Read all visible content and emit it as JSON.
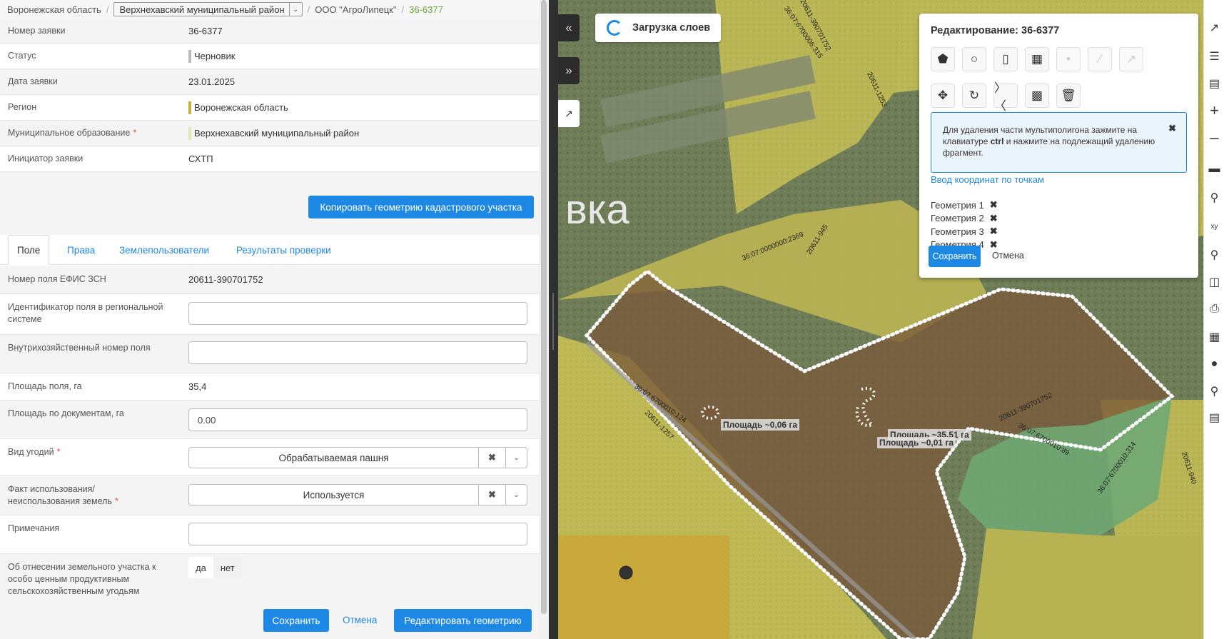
{
  "breadcrumb": {
    "region": "Воронежская область",
    "district": "Верхнехавский муниципальный район",
    "org": "ООО \"АгроЛипецк\"",
    "current": "36-6377"
  },
  "info_rows": [
    {
      "label": "Номер заявки",
      "value": "36-6377"
    },
    {
      "label": "Статус",
      "value": "Черновик",
      "bar": "#bbbbbb"
    },
    {
      "label": "Дата заявки",
      "value": "23.01.2025"
    },
    {
      "label": "Регион",
      "value": "Воронежская область",
      "bar": "#c8b040"
    },
    {
      "label": "Муниципальное образование",
      "value": "Верхнехавский муниципальный район",
      "bar": "#e0e8b0",
      "required": true
    },
    {
      "label": "Инициатор заявки",
      "value": "СХТП"
    }
  ],
  "copy_button": "Копировать геометрию кадастрового участка",
  "tabs": [
    "Поле",
    "Права",
    "Землепользователи",
    "Результаты проверки"
  ],
  "field": {
    "efis_label": "Номер поля ЕФИС ЗСН",
    "efis_value": "20611-390701752",
    "regional_id_label": "Идентификатор поля в региональной системе",
    "regional_id_value": "",
    "internal_no_label": "Внутрихозяйственный номер поля",
    "internal_no_value": "",
    "area_label": "Площадь поля, га",
    "area_value": "35,4",
    "docs_area_label": "Площадь по документам, га",
    "docs_area_value": "0.00",
    "land_type_label": "Вид угодий",
    "land_type_value": "Обрабатываемая пашня",
    "usage_label": "Факт использования/ неиспользования земель",
    "usage_value": "Используется",
    "notes_label": "Примечания",
    "notes_value": "",
    "valuable_label": "Об отнесении земельного участка к особо ценным продуктивным сельскохозяйственным угодьям",
    "yes": "да",
    "no": "нет"
  },
  "footer": {
    "save": "Сохранить",
    "cancel": "Отмена",
    "edit_geometry": "Редактировать геометрию"
  },
  "map": {
    "loading": "Загрузка слоев",
    "edit_title": "Редактирование: 36-6377",
    "hint_pre": "Для удаления части мультиполигона зажмите на клавиатуре ",
    "hint_key": "ctrl",
    "hint_post": " и нажмите на подлежащий удалению фрагмент.",
    "coords_link": "Ввод координат по точкам",
    "geometries": [
      "Геометрия 1",
      "Геометрия 2",
      "Геометрия 3",
      "Геометрия 4"
    ],
    "save": "Сохранить",
    "cancel": "Отмена",
    "area_labels": [
      "Площадь ~0,06 га",
      "Площадь ~35,51 га",
      "Площадь ~0,01 га"
    ],
    "cadastral_labels": [
      "20611-390701752",
      "36:07:6700006:315",
      "20611-1253",
      "36:07:0000000:2369",
      "20611-945",
      "36:07:6700010:124",
      "20611-1257",
      "36:07:6700010:314",
      "20611-940",
      "20611-390701752",
      "36:07:6700010:89"
    ],
    "village_text": "вка"
  },
  "colors": {
    "accent": "#1e88e5",
    "crumb_current": "#67a833",
    "field_fill": "#7a5a3a",
    "parcel_yellow": "#c8c05a"
  }
}
